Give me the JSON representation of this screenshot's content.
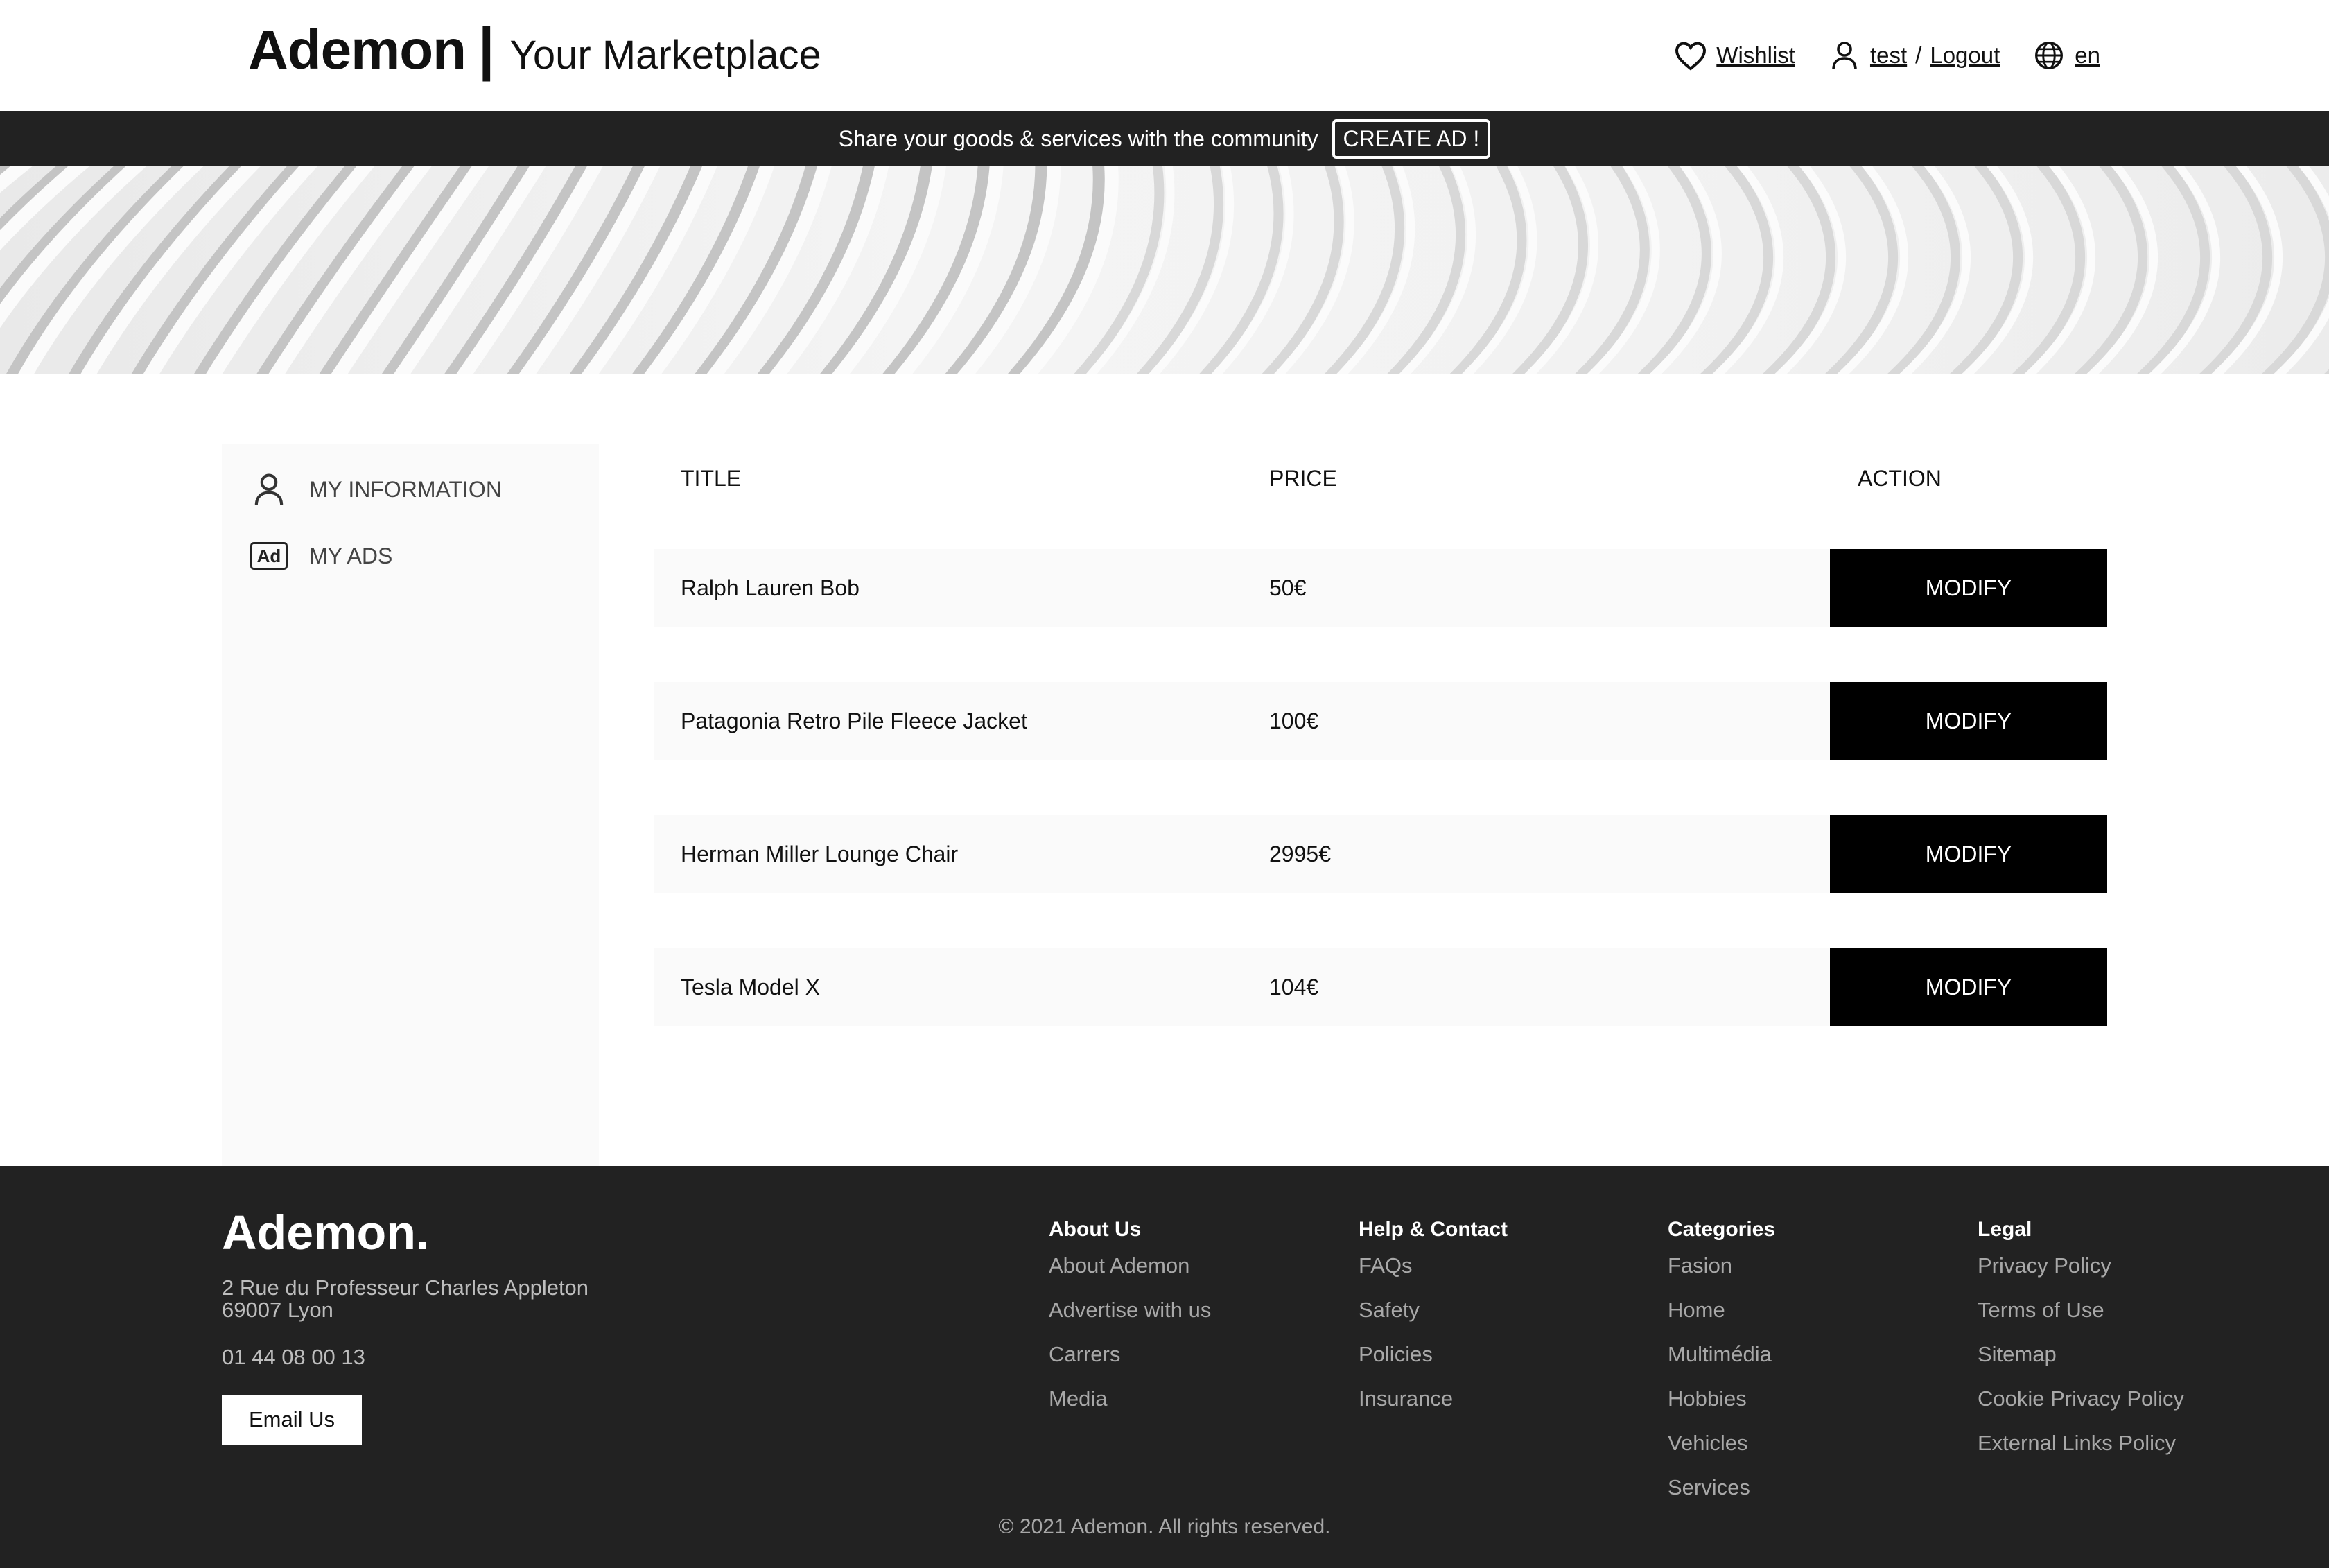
{
  "header": {
    "brand_name": "Ademon",
    "brand_separator": "|",
    "brand_tagline": "Your Marketplace",
    "wishlist_label": "Wishlist",
    "user_name": "test",
    "separator": "/",
    "logout_label": "Logout",
    "language": "en"
  },
  "promo": {
    "text": "Share your goods & services with the community",
    "button_label": "CREATE AD !"
  },
  "sidebar": {
    "items": [
      {
        "label": "MY INFORMATION",
        "icon": "user-icon"
      },
      {
        "label": "MY ADS",
        "icon": "ad-icon"
      }
    ]
  },
  "table": {
    "headers": {
      "title": "TITLE",
      "price": "PRICE",
      "action": "ACTION"
    },
    "rows": [
      {
        "title": "Ralph Lauren Bob",
        "price": "50€",
        "action": "MODIFY"
      },
      {
        "title": "Patagonia Retro Pile Fleece Jacket",
        "price": "100€",
        "action": "MODIFY"
      },
      {
        "title": "Herman Miller Lounge Chair",
        "price": "2995€",
        "action": "MODIFY"
      },
      {
        "title": "Tesla Model X",
        "price": "104€",
        "action": "MODIFY"
      }
    ]
  },
  "footer": {
    "logo": "Ademon.",
    "address_line1": "2 Rue du Professeur Charles Appleton",
    "address_line2": "69007 Lyon",
    "phone": "01 44 08 00 13",
    "email_button": "Email Us",
    "columns": [
      {
        "heading": "About Us",
        "links": [
          "About Ademon",
          "Advertise with us",
          "Carrers",
          "Media"
        ]
      },
      {
        "heading": "Help & Contact",
        "links": [
          "FAQs",
          "Safety",
          "Policies",
          "Insurance"
        ]
      },
      {
        "heading": "Categories",
        "links": [
          "Fasion",
          "Home",
          "Multimédia",
          "Hobbies",
          "Vehicles",
          "Services"
        ]
      },
      {
        "heading": "Legal",
        "links": [
          "Privacy Policy",
          "Terms of Use",
          "Sitemap",
          "Cookie Privacy Policy",
          "External Links Policy"
        ]
      }
    ],
    "copyright": "© 2021 Ademon. All rights reserved."
  },
  "colors": {
    "dark_bar": "#222222",
    "button_black": "#000000",
    "row_bg": "#fafafa",
    "footer_link": "#a8a8a8"
  }
}
